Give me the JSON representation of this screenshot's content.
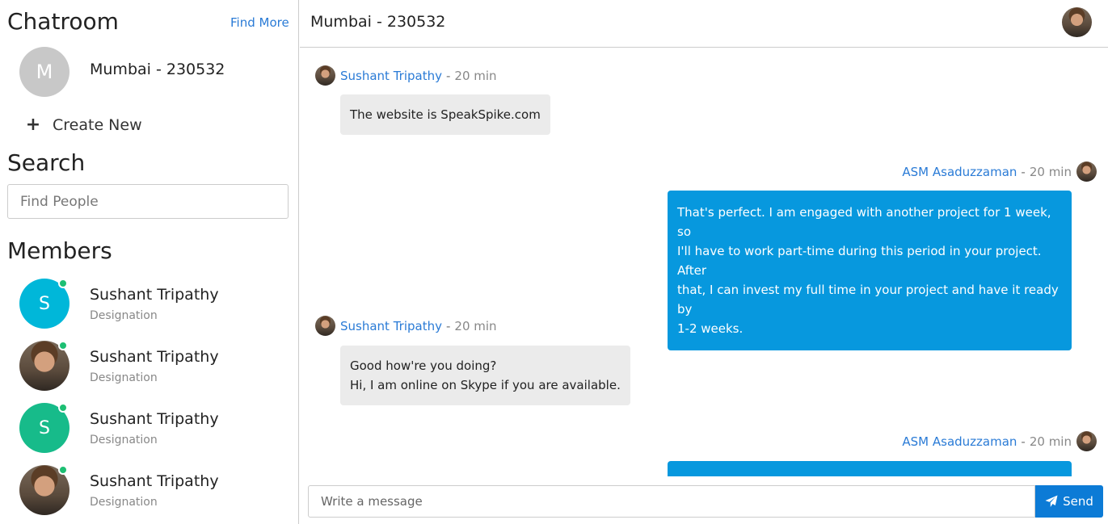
{
  "sidebar": {
    "title": "Chatroom",
    "find_more": "Find More",
    "room": {
      "initial": "M",
      "name": "Mumbai - 230532",
      "avatar_color": "#c8c8c8"
    },
    "create_new": {
      "icon": "+",
      "label": "Create New"
    },
    "search": {
      "title": "Search",
      "placeholder": "Find People"
    },
    "members_title": "Members",
    "members": [
      {
        "name": "Sushant Tripathy",
        "designation": "Designation",
        "initial": "S",
        "avatar_color": "#00b7d9",
        "online": true
      },
      {
        "name": "Sushant Tripathy",
        "designation": "Designation",
        "initial": "",
        "avatar": "photo",
        "online": true
      },
      {
        "name": "Sushant Tripathy",
        "designation": "Designation",
        "initial": "S",
        "avatar_color": "#17bb8a",
        "online": true
      },
      {
        "name": "Sushant Tripathy",
        "designation": "Designation",
        "initial": "",
        "avatar": "photo",
        "online": true
      }
    ]
  },
  "chat": {
    "title": "Mumbai - 230532",
    "messages": [
      {
        "author": "Sushant Tripathy",
        "time": "20 min",
        "direction": "in",
        "lines": [
          "The website is SpeakSpike.com"
        ]
      },
      {
        "author": "ASM Asaduzzaman",
        "time": "20 min",
        "direction": "out",
        "lines": [
          "That's perfect. I am engaged with another project for 1 week, so",
          "I'll have to work part-time during this period in your project. After",
          "that, I can invest my full time in your project and have it ready by",
          "1-2 weeks."
        ]
      },
      {
        "author": "Sushant Tripathy",
        "time": "20 min",
        "direction": "in",
        "lines": [
          "Good how're you doing?",
          "Hi, I am online on Skype if you are available."
        ]
      },
      {
        "author": "ASM Asaduzzaman",
        "time": "20 min",
        "direction": "out",
        "lines": []
      }
    ],
    "separator": "-",
    "composer": {
      "placeholder": "Write a message",
      "send_label": "Send",
      "send_icon": "paper-plane-icon"
    }
  },
  "colors": {
    "link": "#2a7bd6",
    "outgoing_bubble": "#0798de",
    "incoming_bubble": "#ebebeb",
    "online": "#1dbf73",
    "send_button": "#0c7bd6"
  }
}
